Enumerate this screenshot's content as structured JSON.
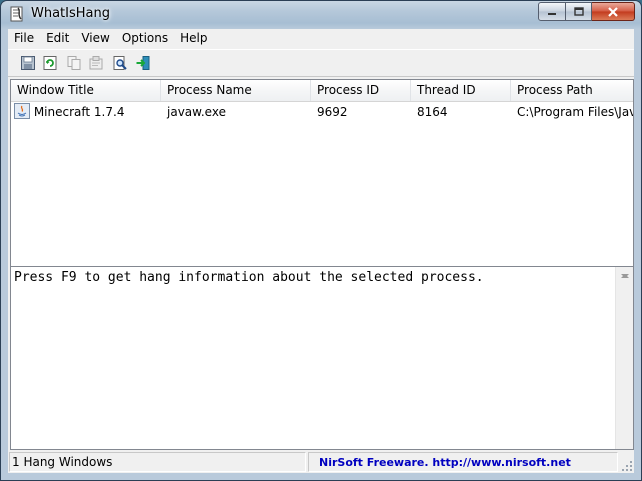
{
  "window": {
    "title": "WhatIsHang",
    "app_icon": "whatishang-app-icon"
  },
  "caption_buttons": {
    "minimize": "minimize-icon",
    "maximize": "maximize-icon",
    "close": "close-icon"
  },
  "menu": [
    "File",
    "Edit",
    "View",
    "Options",
    "Help"
  ],
  "toolbar": [
    "save-icon",
    "refresh-icon",
    "copy-icon",
    "properties-icon",
    "find-icon",
    "exit-icon"
  ],
  "list": {
    "columns": [
      "Window Title",
      "Process Name",
      "Process ID",
      "Thread ID",
      "Process Path"
    ],
    "rows": [
      {
        "icon": "java-app-icon",
        "window_title": "Minecraft 1.7.4",
        "process_name": "javaw.exe",
        "process_id": "9692",
        "thread_id": "8164",
        "process_path": "C:\\Program Files\\Java\\"
      }
    ]
  },
  "info": {
    "message": "Press F9 to get hang information about the selected process."
  },
  "status": {
    "count": "1 Hang Windows",
    "link": "NirSoft Freeware.  http://www.nirsoft.net"
  },
  "colors": {
    "link": "#0000c0",
    "titlebar": "#b5c8da",
    "close_button": "#c8442a"
  }
}
